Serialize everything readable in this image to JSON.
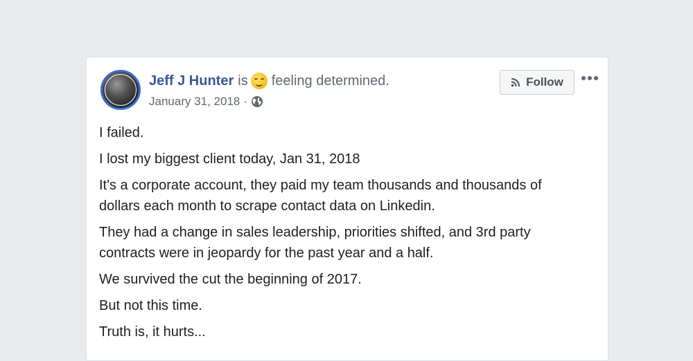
{
  "post": {
    "author": "Jeff J Hunter",
    "is_word": "is",
    "feeling_text": "feeling determined.",
    "date": "January 31, 2018",
    "separator": "·",
    "follow_label": "Follow",
    "paragraphs": [
      "I failed.",
      "I lost my biggest client today, Jan 31, 2018",
      "It's a corporate account, they paid my team thousands and thousands of dollars each month to scrape contact data on Linkedin.",
      "They had a change in sales leadership, priorities shifted, and 3rd party contracts were in jeopardy for the past year and a half.",
      "We survived the cut the beginning of 2017.",
      "But not this time.",
      "Truth is, it hurts..."
    ]
  },
  "icons": {
    "feeling": "smiling-face-icon",
    "privacy": "globe-icon",
    "follow": "rss-icon",
    "more": "more-options-icon"
  },
  "colors": {
    "background": "#e9ebee",
    "author": "#385898",
    "avatar_ring": "#3a6fd0",
    "meta_text": "#606770",
    "body_text": "#1c1e21"
  }
}
